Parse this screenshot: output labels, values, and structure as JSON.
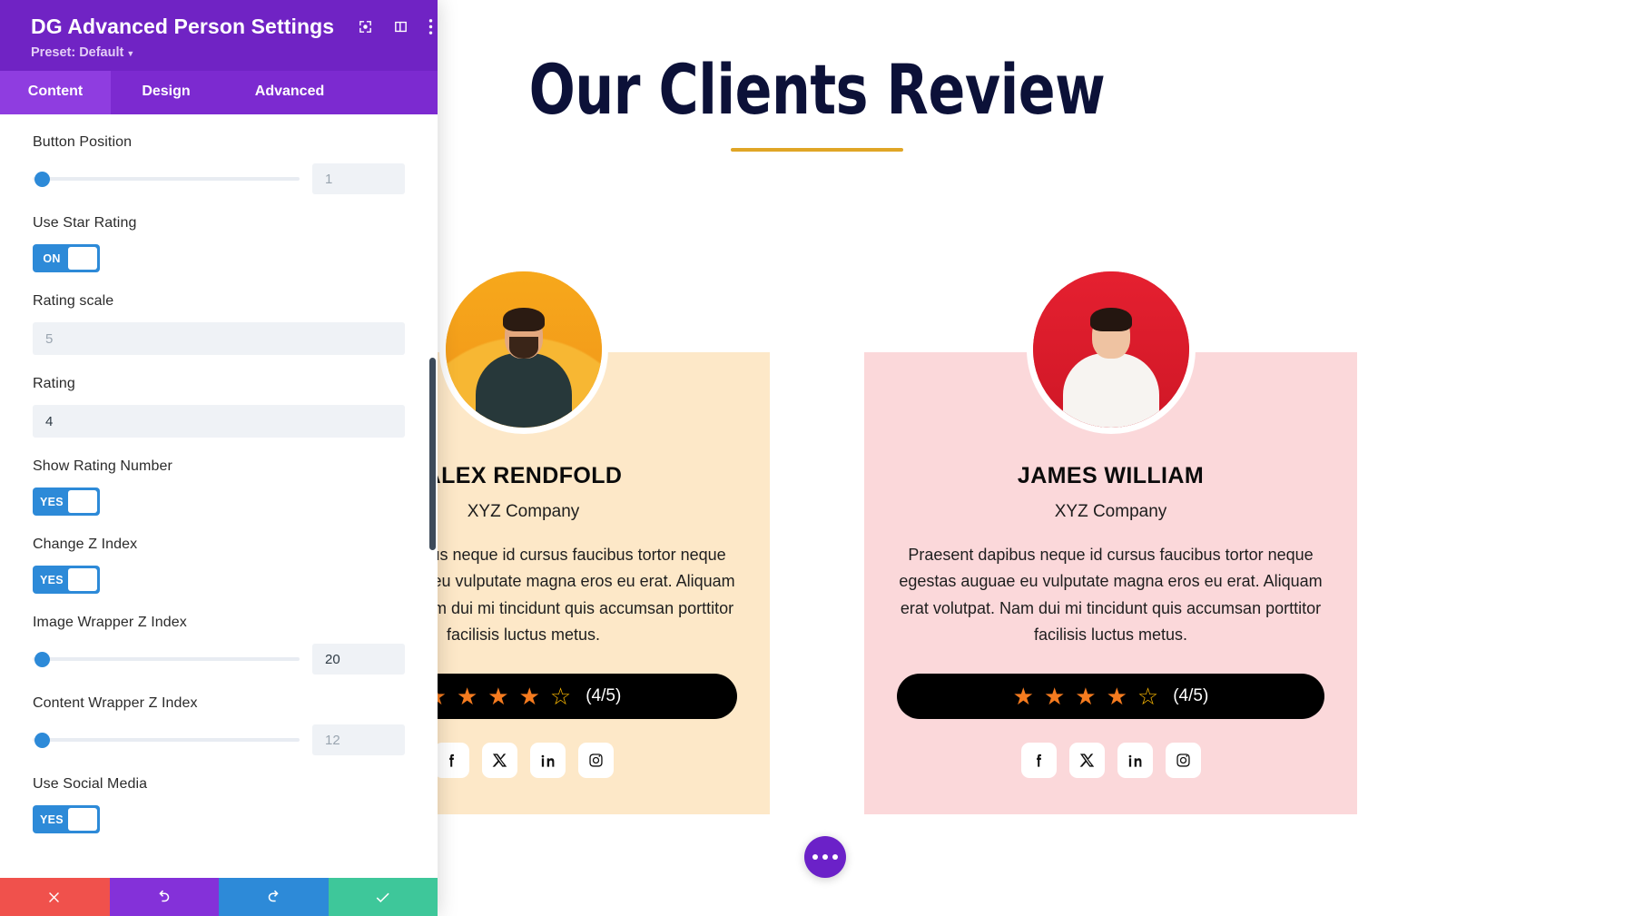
{
  "panel": {
    "title": "DG Advanced Person Settings",
    "preset_label": "Preset: Default",
    "header_icons": [
      {
        "name": "focus-target-icon"
      },
      {
        "name": "layout-panel-icon"
      },
      {
        "name": "more-vertical-icon"
      }
    ],
    "tabs": [
      {
        "label": "Content",
        "active": true
      },
      {
        "label": "Design",
        "active": false
      },
      {
        "label": "Advanced",
        "active": false
      }
    ],
    "fields": [
      {
        "type": "slider",
        "label": "Button Position",
        "value": "1",
        "is_placeholder": true
      },
      {
        "type": "toggle",
        "label": "Use Star Rating",
        "state": "ON"
      },
      {
        "type": "text",
        "label": "Rating scale",
        "value": "5",
        "is_placeholder": true
      },
      {
        "type": "text",
        "label": "Rating",
        "value": "4",
        "is_placeholder": false
      },
      {
        "type": "toggle",
        "label": "Show Rating Number",
        "state": "YES"
      },
      {
        "type": "toggle",
        "label": "Change Z Index",
        "state": "YES"
      },
      {
        "type": "slider",
        "label": "Image Wrapper Z Index",
        "value": "20",
        "is_placeholder": false
      },
      {
        "type": "slider",
        "label": "Content Wrapper Z Index",
        "value": "12",
        "is_placeholder": true
      },
      {
        "type": "toggle",
        "label": "Use Social Media",
        "state": "YES"
      }
    ],
    "footer": [
      {
        "name": "cancel-button",
        "icon": "close-icon"
      },
      {
        "name": "undo-button",
        "icon": "undo-icon"
      },
      {
        "name": "redo-button",
        "icon": "redo-icon"
      },
      {
        "name": "save-button",
        "icon": "check-icon"
      }
    ]
  },
  "page": {
    "heading": "Our Clients Review",
    "cards": [
      {
        "name": "ALEX RENDFOLD",
        "company": "XYZ Company",
        "text": "Praesent dapibus neque id cursus faucibus tortor neque egestas auguae eu vulputate magna eros eu erat. Aliquam erat volutpat. Nam dui mi tincidunt quis accumsan porttitor facilisis luctus metus.",
        "rating_filled": 4,
        "rating_total": 5,
        "rating_text": "(4/5)",
        "card_color": "#fde8c8",
        "avatar_bg": "#f5a623",
        "socials": [
          "facebook-icon",
          "x-twitter-icon",
          "linkedin-icon",
          "instagram-icon"
        ]
      },
      {
        "name": "JAMES WILLIAM",
        "company": "XYZ Company",
        "text": "Praesent dapibus neque id cursus faucibus tortor neque egestas auguae eu vulputate magna eros eu erat. Aliquam erat volutpat. Nam dui mi tincidunt quis accumsan porttitor facilisis luctus metus.",
        "rating_filled": 4,
        "rating_total": 5,
        "rating_text": "(4/5)",
        "card_color": "#fbd8da",
        "avatar_bg": "#e01f2d",
        "socials": [
          "facebook-icon",
          "x-twitter-icon",
          "linkedin-icon",
          "instagram-icon"
        ]
      }
    ],
    "fab": {
      "name": "more-options-fab"
    }
  },
  "colors": {
    "brand_purple": "#7023c4",
    "tab_active": "#8f3de0",
    "accent_blue": "#2d8ad8",
    "heading_navy": "#0c1138",
    "heading_rule": "#e0a526",
    "star_filled": "#f57b1f",
    "star_empty": "#f7b500"
  }
}
